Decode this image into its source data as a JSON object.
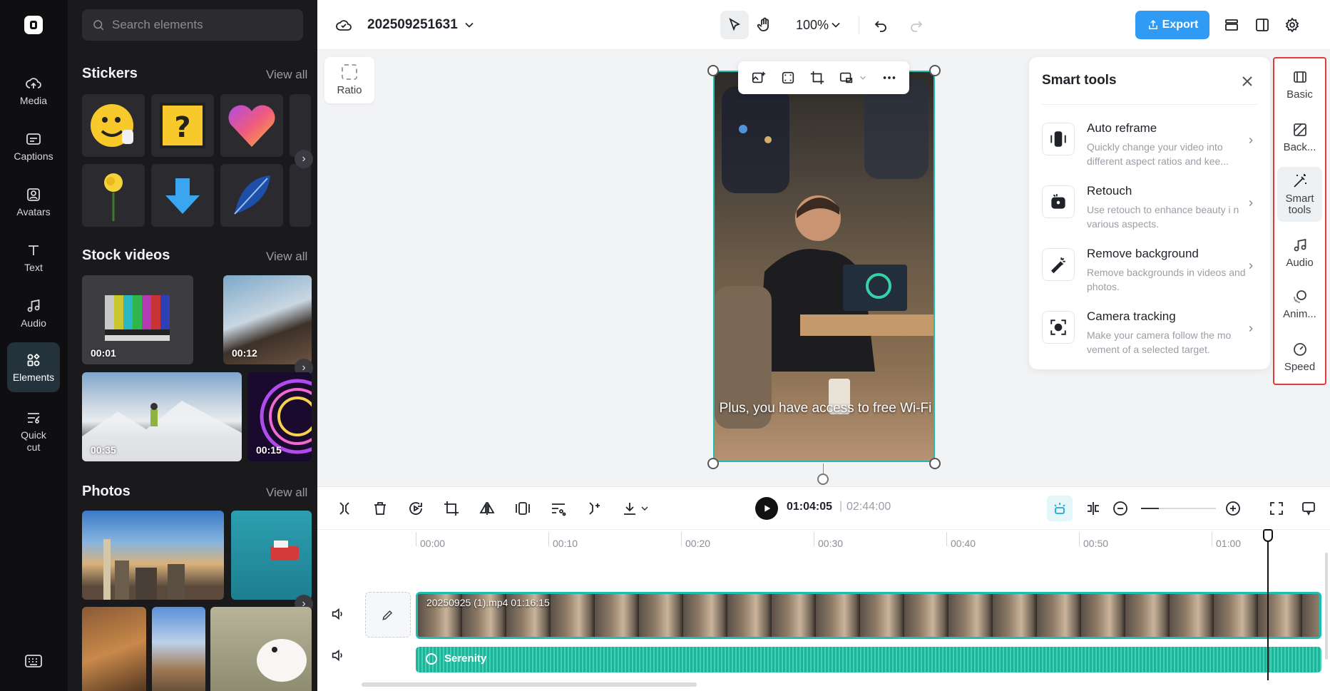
{
  "nav": {
    "items": [
      {
        "label": "Media",
        "icon": "cloud-upload-icon"
      },
      {
        "label": "Captions",
        "icon": "captions-icon"
      },
      {
        "label": "Avatars",
        "icon": "avatar-icon"
      },
      {
        "label": "Text",
        "icon": "text-icon"
      },
      {
        "label": "Audio",
        "icon": "music-note-icon"
      },
      {
        "label": "Elements",
        "icon": "elements-icon",
        "active": true
      },
      {
        "label": "Quick cut",
        "icon": "quick-cut-icon"
      }
    ]
  },
  "panel": {
    "search_placeholder": "Search elements",
    "stickers": {
      "title": "Stickers",
      "view_all": "View all"
    },
    "stock_videos": {
      "title": "Stock videos",
      "view_all": "View all",
      "items": [
        {
          "duration": "00:01"
        },
        {
          "duration": "00:12"
        },
        {
          "duration": "00:35"
        },
        {
          "duration": "00:15"
        }
      ]
    },
    "photos": {
      "title": "Photos",
      "view_all": "View all"
    }
  },
  "topbar": {
    "project_name": "202509251631",
    "zoom": "100%",
    "export_label": "Export"
  },
  "canvas": {
    "ratio_label": "Ratio",
    "caption": "Plus, you have access to free Wi-Fi"
  },
  "smart_tools": {
    "title": "Smart tools",
    "tools": [
      {
        "name": "Auto reframe",
        "desc": "Quickly change your video into different aspect ratios and kee...",
        "icon": "auto-reframe-icon"
      },
      {
        "name": "Retouch",
        "desc": "Use retouch to enhance beauty i n various aspects.",
        "icon": "retouch-icon"
      },
      {
        "name": "Remove background",
        "desc": "Remove backgrounds in videos and photos.",
        "icon": "remove-background-icon"
      },
      {
        "name": "Camera tracking",
        "desc": "Make your camera follow the mo vement of a selected target.",
        "icon": "camera-tracking-icon"
      }
    ]
  },
  "rail": {
    "items": [
      {
        "label": "Basic",
        "icon": "basic-icon"
      },
      {
        "label": "Back...",
        "icon": "background-icon"
      },
      {
        "label": "Smart tools",
        "icon": "magic-wand-icon",
        "active": true
      },
      {
        "label": "Audio",
        "icon": "music-note-icon"
      },
      {
        "label": "Anim...",
        "icon": "animation-icon"
      },
      {
        "label": "Speed",
        "icon": "speed-icon"
      }
    ]
  },
  "timeline": {
    "current_time": "01:04:05",
    "separator": "|",
    "total_time": "02:44:00",
    "ruler": [
      "00:00",
      "00:10",
      "00:20",
      "00:30",
      "00:40",
      "00:50",
      "01:00"
    ],
    "video_clip_label": "20250925 (1).mp4   01:16:15",
    "audio_clip_label": "Serenity"
  },
  "colors": {
    "accent": "#2f9bf5",
    "selection": "#1fbcb2",
    "highlight_border": "#e23b3b"
  }
}
